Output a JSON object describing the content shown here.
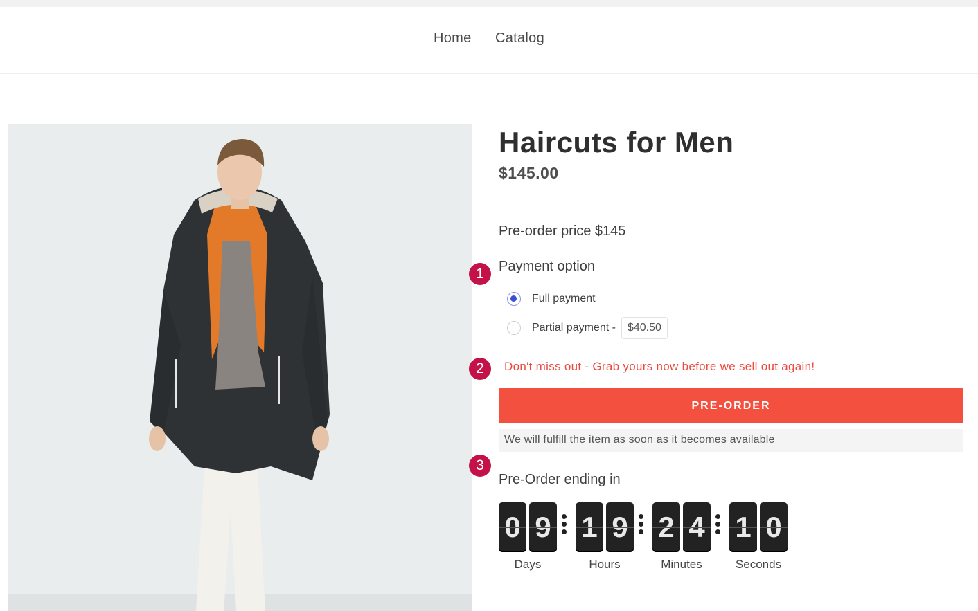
{
  "nav": {
    "items": [
      "Home",
      "Catalog"
    ]
  },
  "product": {
    "title": "Haircuts for Men",
    "price": "$145.00",
    "preorder_price": "Pre-order price $145",
    "payment_label": "Payment option",
    "options": {
      "full_label": "Full payment",
      "full_selected": true,
      "partial_label": "Partial payment -",
      "partial_amount": "$40.50",
      "partial_selected": false
    },
    "urgency_message": "Don't miss out - Grab yours now before we sell out again!",
    "preorder_button": "PRE-ORDER",
    "fulfill_note": "We will fulfill the item as soon as it becomes available",
    "ending_label": "Pre-Order ending in"
  },
  "countdown": {
    "days": [
      "0",
      "9"
    ],
    "hours": [
      "1",
      "9"
    ],
    "minutes": [
      "2",
      "4"
    ],
    "seconds": [
      "1",
      "0"
    ],
    "labels": {
      "days": "Days",
      "hours": "Hours",
      "minutes": "Minutes",
      "seconds": "Seconds"
    }
  },
  "markers": [
    "1",
    "2",
    "3"
  ],
  "colors": {
    "accent": "#f4503f",
    "urgency_text": "#ea4a3f",
    "marker": "#c41248",
    "radio_selected": "#3c4fd4",
    "countdown_tile": "#222222"
  },
  "icons": {
    "radio_selected": "radio-checked-icon",
    "radio_unselected": "radio-unchecked-icon"
  }
}
